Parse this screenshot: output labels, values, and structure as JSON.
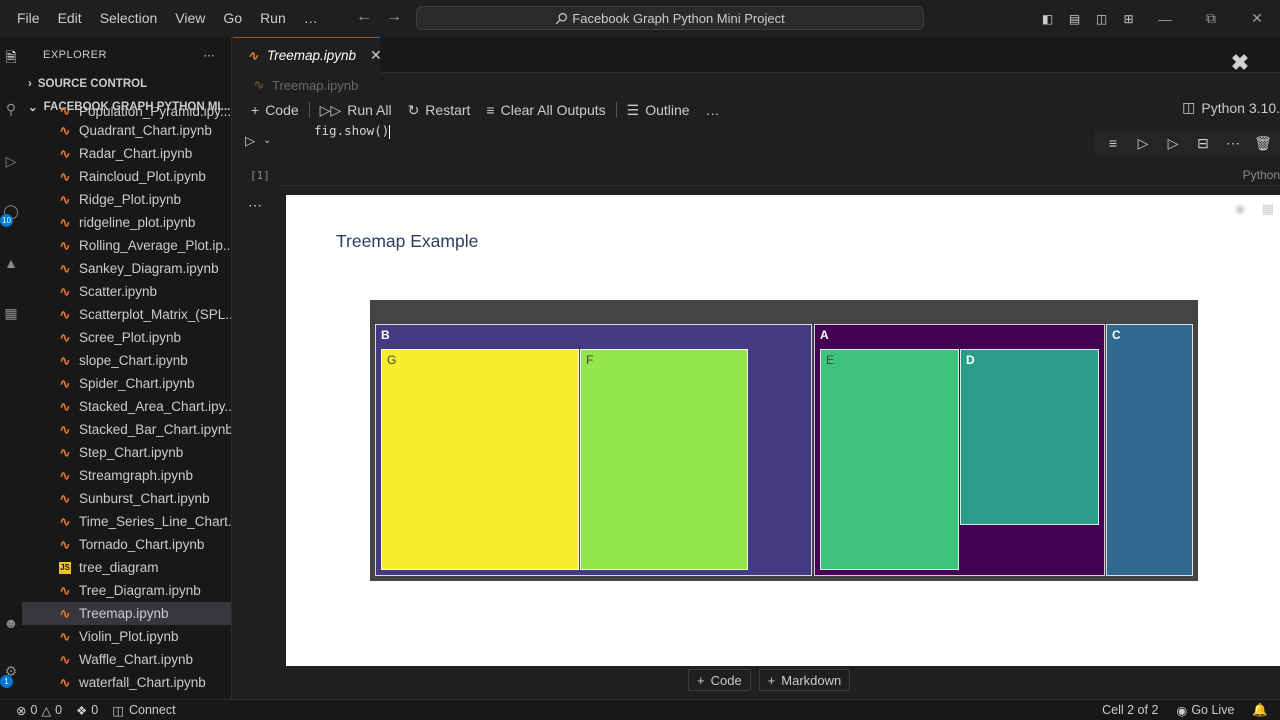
{
  "menu": [
    "File",
    "Edit",
    "Selection",
    "View",
    "Go",
    "Run",
    "…"
  ],
  "search": {
    "label": "Facebook Graph Python Mini Project"
  },
  "sidebar": {
    "header": "EXPLORER",
    "source_control": "SOURCE CONTROL",
    "project": "FACEBOOK GRAPH PYTHON MI...",
    "items": [
      {
        "label": "Population_Pyramid.ipy..."
      },
      {
        "label": "Quadrant_Chart.ipynb"
      },
      {
        "label": "Radar_Chart.ipynb"
      },
      {
        "label": "Raincloud_Plot.ipynb"
      },
      {
        "label": "Ridge_Plot.ipynb"
      },
      {
        "label": "ridgeline_plot.ipynb"
      },
      {
        "label": "Rolling_Average_Plot.ip..."
      },
      {
        "label": "Sankey_Diagram.ipynb"
      },
      {
        "label": "Scatter.ipynb"
      },
      {
        "label": "Scatterplot_Matrix_(SPL..."
      },
      {
        "label": "Scree_Plot.ipynb"
      },
      {
        "label": "slope_Chart.ipynb"
      },
      {
        "label": "Spider_Chart.ipynb"
      },
      {
        "label": "Stacked_Area_Chart.ipy..."
      },
      {
        "label": "Stacked_Bar_Chart.ipynb"
      },
      {
        "label": "Step_Chart.ipynb"
      },
      {
        "label": "Streamgraph.ipynb"
      },
      {
        "label": "Sunburst_Chart.ipynb"
      },
      {
        "label": "Time_Series_Line_Chart..."
      },
      {
        "label": "Tornado_Chart.ipynb"
      },
      {
        "label": "tree_diagram"
      },
      {
        "label": "Tree_Diagram.ipynb"
      },
      {
        "label": "Treemap.ipynb"
      },
      {
        "label": "Violin_Plot.ipynb"
      },
      {
        "label": "Waffle_Chart.ipynb"
      },
      {
        "label": "waterfall_Chart.ipynb"
      }
    ]
  },
  "activity": {
    "badge_scm": "10",
    "badge_account": "1"
  },
  "tab": {
    "title": "Treemap.ipynb"
  },
  "breadcrumb": "Treemap.ipynb",
  "toolbar": {
    "code": "Code",
    "run_all": "Run All",
    "restart": "Restart",
    "clear_all_outputs": "Clear All Outputs",
    "outline": "Outline",
    "more": "…",
    "kernel": "Python 3.10."
  },
  "cell": {
    "code": "fig.show()",
    "exec_count": "[1]",
    "language": "Python"
  },
  "chart_data": {
    "type": "treemap",
    "title": "Treemap Example",
    "nodes": [
      {
        "label": "B",
        "parent": "",
        "color": "#443983"
      },
      {
        "label": "G",
        "parent": "B",
        "color": "#f8ee2d"
      },
      {
        "label": "F",
        "parent": "B",
        "color": "#94e44b"
      },
      {
        "label": "A",
        "parent": "",
        "color": "#440154"
      },
      {
        "label": "E",
        "parent": "A",
        "color": "#3ec37b"
      },
      {
        "label": "D",
        "parent": "A",
        "color": "#2a9d8a"
      },
      {
        "label": "C",
        "parent": "",
        "color": "#31688e"
      }
    ]
  },
  "add_bar": {
    "code": "Code",
    "markdown": "Markdown"
  },
  "status": {
    "errors": "0",
    "warnings": "0",
    "ports": "0",
    "connect": "Connect",
    "cell_pos": "Cell 2 of 2",
    "go_live": "Go Live"
  }
}
